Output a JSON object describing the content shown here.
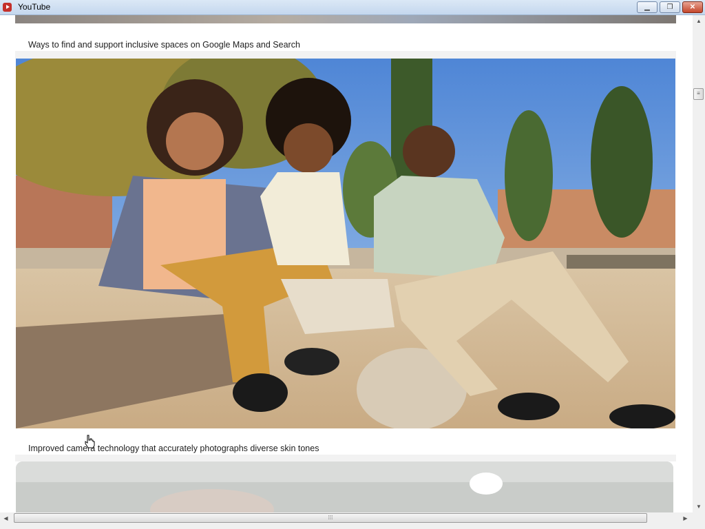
{
  "window": {
    "title": "YouTube",
    "minimize_label": "▁",
    "restore_label": "❐",
    "close_label": "✕"
  },
  "main": {
    "items": [
      {
        "caption": "Ways to find and support inclusive spaces on Google Maps and Search"
      },
      {
        "caption": "Improved camera technology that accurately photographs diverse skin tones"
      }
    ]
  },
  "scrollbars": {
    "vertical_thumb_grip": "≡",
    "horizontal_thumb_grip": "⁞⁞⁞",
    "up_arrow": "▲",
    "down_arrow": "▼",
    "left_arrow": "◀",
    "right_arrow": "▶"
  }
}
